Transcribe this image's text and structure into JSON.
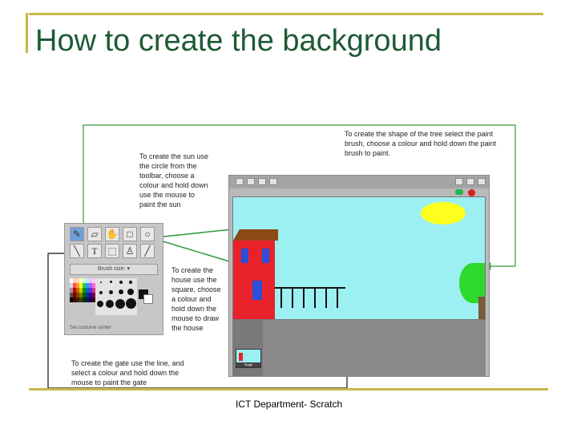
{
  "title": "How to create the background",
  "footer": "ICT Department- Scratch",
  "notes": {
    "tree": [
      "To create the shape of the tree select the paint",
      "brush, choose a colour and hold down the paint",
      "brush to paint."
    ],
    "sun": [
      "To create the sun use",
      "the circle from the",
      "toolbar, choose a",
      "colour and hold down",
      "use the mouse to",
      "paint the sun"
    ],
    "house": [
      "To create the",
      "house use the",
      "square, choose",
      "a colour and",
      "hold down the",
      "mouse to draw",
      "the house"
    ],
    "gate": [
      "To create the gate use the line, and",
      "select a colour and hold down the",
      "mouse to paint the gate"
    ]
  },
  "paint_toolbar": {
    "tools": [
      "paintbrush",
      "eraser",
      "fill",
      "rectangle",
      "ellipse",
      "line",
      "text",
      "select",
      "stamp",
      "eyedropper"
    ],
    "brush_size_label": "Brush size:",
    "set_costume_label": "Set costume center"
  },
  "scratch": {
    "sprite_label": "Stage",
    "colors": {
      "stage_bg": "#9cf0f2",
      "sun": "#ffff1e",
      "house": "#e8222b",
      "roof": "#8c4a14",
      "windows": "#2a4fd8",
      "tree": "#2dd92d",
      "trunk": "#7a5a3a"
    }
  },
  "colors": {
    "title": "#1e5a34",
    "frame_lines": "#c8b84a",
    "arrow_green": "#2e9a3c"
  }
}
